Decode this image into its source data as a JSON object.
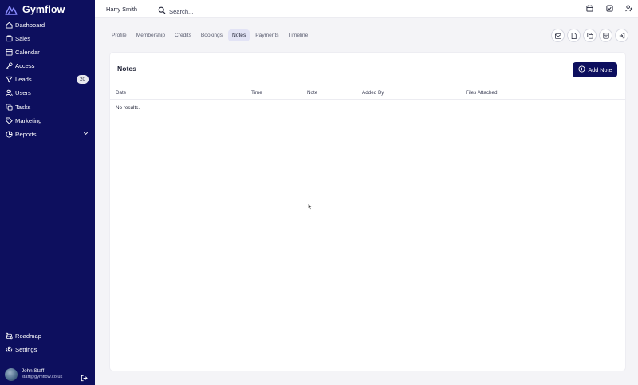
{
  "brand": {
    "name": "Gymflow"
  },
  "sidebar": {
    "items": [
      {
        "label": "Dashboard",
        "icon": "home-icon"
      },
      {
        "label": "Sales",
        "icon": "tag-icon"
      },
      {
        "label": "Calendar",
        "icon": "calendar-icon"
      },
      {
        "label": "Access",
        "icon": "key-icon"
      },
      {
        "label": "Leads",
        "icon": "filter-icon",
        "badge": "20"
      },
      {
        "label": "Users",
        "icon": "users-icon"
      },
      {
        "label": "Tasks",
        "icon": "checklist-icon"
      },
      {
        "label": "Marketing",
        "icon": "label-icon"
      },
      {
        "label": "Reports",
        "icon": "pie-chart-icon"
      }
    ],
    "bottom": [
      {
        "label": "Roadmap",
        "icon": "route-icon"
      },
      {
        "label": "Settings",
        "icon": "gear-icon"
      }
    ],
    "user": {
      "name": "John Staff",
      "email": "staff@gymflow.co.uk"
    }
  },
  "topbar": {
    "member_name": "Harry Smith",
    "search_placeholder": "Search..."
  },
  "tabs": [
    {
      "label": "Profile",
      "active": false
    },
    {
      "label": "Membership",
      "active": false
    },
    {
      "label": "Credits",
      "active": false
    },
    {
      "label": "Bookings",
      "active": false
    },
    {
      "label": "Notes",
      "active": true
    },
    {
      "label": "Payments",
      "active": false
    },
    {
      "label": "Timeline",
      "active": false
    }
  ],
  "notes": {
    "title": "Notes",
    "add_button": "Add Note",
    "columns": [
      "Date",
      "Time",
      "Note",
      "Added By",
      "Files Attached"
    ],
    "empty_text": "No results."
  },
  "colors": {
    "sidebar_bg": "#0d0f5e",
    "accent": "#0d0f5e",
    "active_tab_bg": "#e2e3f5"
  }
}
